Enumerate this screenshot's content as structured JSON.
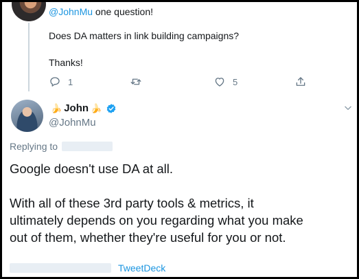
{
  "parent_tweet": {
    "mention": "@JohnMu",
    "head_text": " one question!",
    "line1": "Does DA matters in link building campaigns?",
    "line2": "Thanks!",
    "reply_count": "1",
    "like_count": "5"
  },
  "main_tweet": {
    "name": "John",
    "name_emoji": "🍌",
    "handle": "@JohnMu",
    "replying_label": "Replying to",
    "paragraph1": "Google doesn't use DA at all.",
    "paragraph2_lines": [
      "With all of these 3rd party tools & metrics, it",
      "ultimately depends on you regarding what you make",
      "out of them, whether they're useful for you or not."
    ],
    "source": "TweetDeck"
  },
  "colors": {
    "link": "#1b95e0",
    "muted": "#657786",
    "verified": "#1da1f2",
    "border": "#000000"
  },
  "icons": [
    "reply-icon",
    "retweet-icon",
    "like-icon",
    "share-icon",
    "verified-icon",
    "chevron-down-icon"
  ]
}
